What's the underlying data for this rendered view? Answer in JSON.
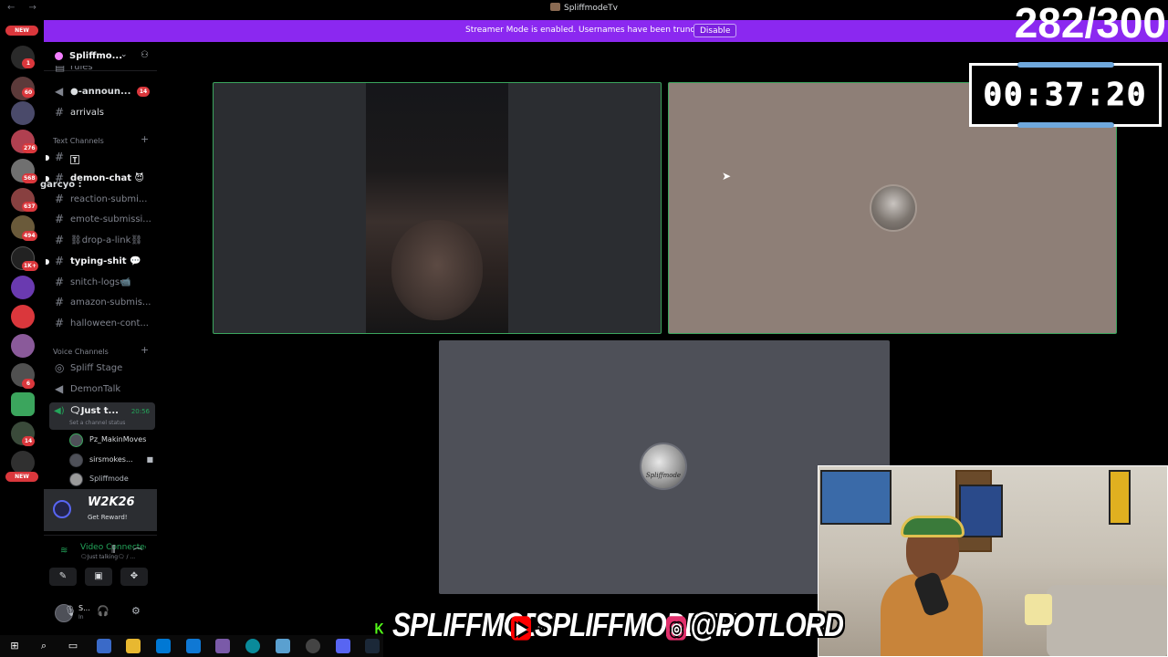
{
  "window": {
    "title": "SpliffmodeTv"
  },
  "banner": {
    "text": "Streamer Mode is enabled. Usernames have been truncated.",
    "disable_label": "Disable"
  },
  "servers": {
    "badges": [
      "NEW",
      "1",
      "60",
      "276",
      "568",
      "637",
      "494",
      "1K+",
      "6",
      "14",
      "NEW"
    ]
  },
  "guild": {
    "name": "Spliffmo..."
  },
  "channels": {
    "top": [
      {
        "name": "rules",
        "icon": "hash-icon"
      },
      {
        "name": "●-announ...",
        "icon": "speaker-icon",
        "badge": "14"
      },
      {
        "name": "arrivals",
        "icon": "hash-icon"
      }
    ],
    "text_category": "Text Channels",
    "text": [
      {
        "name": "🅃",
        "bright": true
      },
      {
        "name": "demon-chat 😈",
        "bright": true
      },
      {
        "name": "reaction-submi...",
        "bright": false
      },
      {
        "name": "emote-submissi...",
        "bright": false
      },
      {
        "name": "⛓drop-a-link⛓",
        "bright": false
      },
      {
        "name": "typing-shit 💬",
        "bright": true
      },
      {
        "name": "snitch-logs📹",
        "bright": false
      },
      {
        "name": "amazon-submis...",
        "bright": false
      },
      {
        "name": "halloween-cont...",
        "bright": false
      }
    ],
    "voice_category": "Voice Channels",
    "voice": [
      {
        "name": "Spliff Stage",
        "icon": "stage-icon"
      },
      {
        "name": "DemonTalk",
        "icon": "speaker-icon"
      }
    ],
    "active_voice": {
      "name": "🗨Just t...",
      "time": "20:56",
      "status": "Set a channel status"
    },
    "voice_users": [
      {
        "name": "Pz_MakinMoves",
        "camera": false
      },
      {
        "name": "sirsmokes...",
        "camera": true
      },
      {
        "name": "Spliffmode",
        "camera": false
      }
    ]
  },
  "hover_user": "garcyo :",
  "reward": {
    "title": "W2K26",
    "label": "Get Reward!"
  },
  "voice_panel": {
    "title": "Video Connected",
    "subtitle": "🗨Just talking🗨 / ..."
  },
  "user": {
    "name": "S...",
    "status": "In"
  },
  "overlay": {
    "counter": "282/300",
    "timer": "00:37:20",
    "tile3_label": "Spliffmode"
  },
  "socials": [
    {
      "handle": "SPLIFFMODE",
      "platform": "kick",
      "color": "#53fc18"
    },
    {
      "handle": "SPLIFFMODETV",
      "platform": "youtube",
      "color": "#ff0000"
    },
    {
      "handle": "@POTLORD",
      "platform": "instagram",
      "color": "#e1306c"
    }
  ]
}
